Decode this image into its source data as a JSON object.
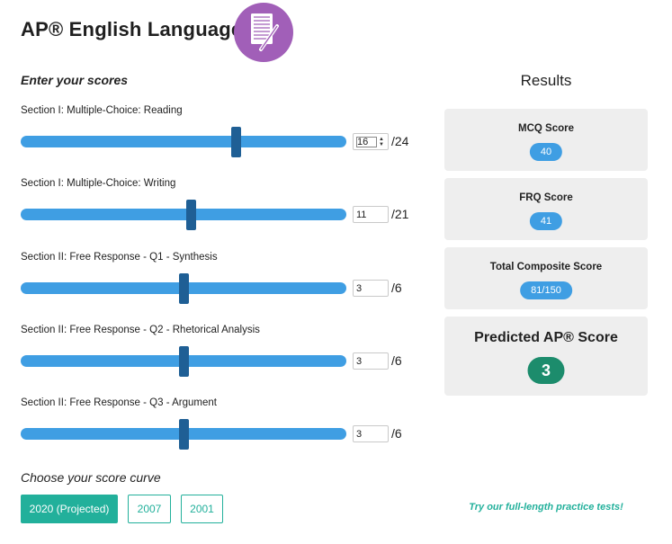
{
  "header": {
    "title": "AP® English Language",
    "logo_icon": "notepad-pencil-icon",
    "logo_color": "#a15fb8"
  },
  "inputs": {
    "heading": "Enter your scores",
    "sections": [
      {
        "label": "Section I: Multiple-Choice: Reading",
        "value": "16",
        "max": "/24",
        "fill_fraction": 0.6667,
        "focused": true
      },
      {
        "label": "Section I: Multiple-Choice: Writing",
        "value": "11",
        "max": "/21",
        "fill_fraction": 0.5238,
        "focused": false
      },
      {
        "label": "Section II: Free Response - Q1 - Synthesis",
        "value": "3",
        "max": "/6",
        "fill_fraction": 0.5,
        "focused": false
      },
      {
        "label": "Section II: Free Response - Q2 - Rhetorical Analysis",
        "value": "3",
        "max": "/6",
        "fill_fraction": 0.5,
        "focused": false
      },
      {
        "label": "Section II: Free Response - Q3 - Argument",
        "value": "3",
        "max": "/6",
        "fill_fraction": 0.5,
        "focused": false
      }
    ]
  },
  "curve": {
    "heading": "Choose your score curve",
    "options": [
      {
        "label": "2020 (Projected)",
        "active": true
      },
      {
        "label": "2007",
        "active": false
      },
      {
        "label": "2001",
        "active": false
      }
    ]
  },
  "results": {
    "title": "Results",
    "mcq": {
      "label": "MCQ Score",
      "value": "40"
    },
    "frq": {
      "label": "FRQ Score",
      "value": "41"
    },
    "composite": {
      "label": "Total Composite Score",
      "value": "81/150"
    },
    "predicted": {
      "label": "Predicted AP® Score",
      "value": "3"
    }
  },
  "promo": {
    "text": "Try our full-length practice tests!"
  },
  "colors": {
    "slider_track": "#3f9ee3",
    "slider_thumb": "#1f5f95",
    "accent_teal": "#22b09b",
    "predicted_badge": "#1c8c6c",
    "card_bg": "#eeeeee"
  }
}
